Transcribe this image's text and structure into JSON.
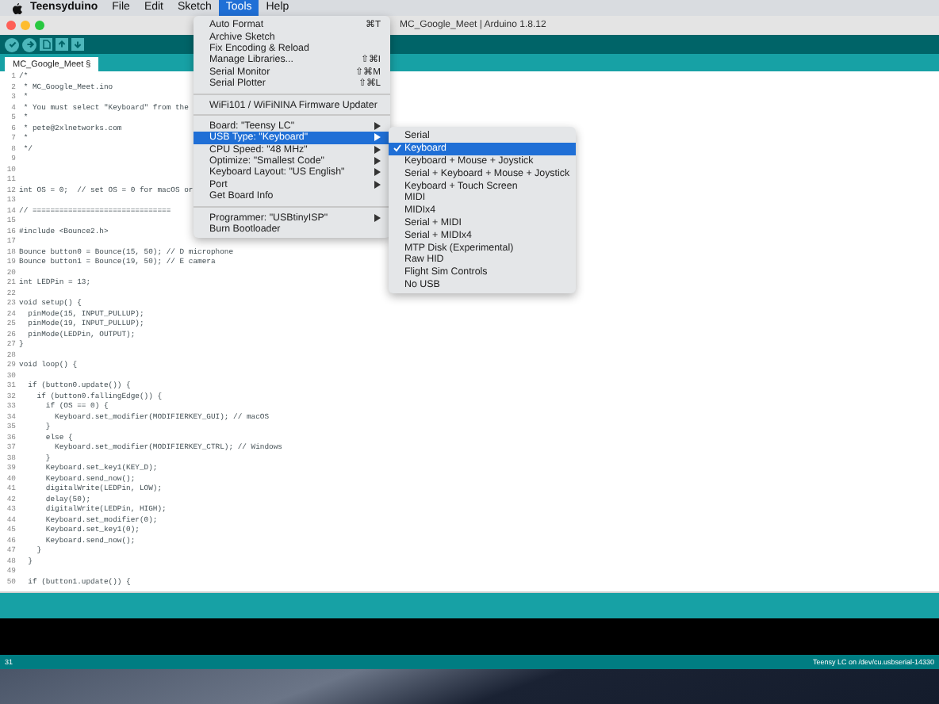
{
  "menubar": {
    "items": [
      {
        "label": "Teensyduino",
        "kind": "app",
        "selected": false
      },
      {
        "label": "File",
        "kind": "menu",
        "selected": false
      },
      {
        "label": "Edit",
        "kind": "menu",
        "selected": false
      },
      {
        "label": "Sketch",
        "kind": "menu",
        "selected": false
      },
      {
        "label": "Tools",
        "kind": "menu",
        "selected": true
      },
      {
        "label": "Help",
        "kind": "menu",
        "selected": false
      }
    ]
  },
  "window": {
    "title": "MC_Google_Meet | Arduino 1.8.12"
  },
  "tabs": [
    {
      "label": "MC_Google_Meet §",
      "selected": true
    }
  ],
  "editor": {
    "lines": [
      {
        "number": "1",
        "code": "/*"
      },
      {
        "number": "2",
        "code": " * MC_Google_Meet.ino"
      },
      {
        "number": "3",
        "code": " *"
      },
      {
        "number": "4",
        "code": " * You must select \"Keyboard\" from the"
      },
      {
        "number": "5",
        "code": " *"
      },
      {
        "number": "6",
        "code": " * pete@2xlnetworks.com"
      },
      {
        "number": "7",
        "code": " *"
      },
      {
        "number": "8",
        "code": " */"
      },
      {
        "number": "9"
      },
      {
        "number": "10"
      },
      {
        "number": "11"
      },
      {
        "number": "12",
        "code": "int OS = 0;  // set OS = 0 for macOS or"
      },
      {
        "number": "13"
      },
      {
        "number": "14",
        "code": "// ==============================="
      },
      {
        "number": "15"
      },
      {
        "number": "16",
        "code": "#include <Bounce2.h>"
      },
      {
        "number": "17"
      },
      {
        "number": "18",
        "code": "Bounce button0 = Bounce(15, 50); // D microphone"
      },
      {
        "number": "19",
        "code": "Bounce button1 = Bounce(19, 50); // E camera"
      },
      {
        "number": "20"
      },
      {
        "number": "21",
        "code": "int LEDPin = 13;"
      },
      {
        "number": "22"
      },
      {
        "number": "23",
        "code": "void setup() {"
      },
      {
        "number": "24",
        "code": "  pinMode(15, INPUT_PULLUP);"
      },
      {
        "number": "25",
        "code": "  pinMode(19, INPUT_PULLUP);"
      },
      {
        "number": "26",
        "code": "  pinMode(LEDPin, OUTPUT);"
      },
      {
        "number": "27",
        "code": "}"
      },
      {
        "number": "28"
      },
      {
        "number": "29",
        "code": "void loop() {"
      },
      {
        "number": "30"
      },
      {
        "number": "31",
        "code": "  if (button0.update()) {"
      },
      {
        "number": "32",
        "code": "    if (button0.fallingEdge()) {"
      },
      {
        "number": "33",
        "code": "      if (OS == 0) {"
      },
      {
        "number": "34",
        "code": "        Keyboard.set_modifier(MODIFIERKEY_GUI); // macOS"
      },
      {
        "number": "35",
        "code": "      }"
      },
      {
        "number": "36",
        "code": "      else {"
      },
      {
        "number": "37",
        "code": "        Keyboard.set_modifier(MODIFIERKEY_CTRL); // Windows"
      },
      {
        "number": "38",
        "code": "      }"
      },
      {
        "number": "39",
        "code": "      Keyboard.set_key1(KEY_D);"
      },
      {
        "number": "40",
        "code": "      Keyboard.send_now();"
      },
      {
        "number": "41",
        "code": "      digitalWrite(LEDPin, LOW);"
      },
      {
        "number": "42",
        "code": "      delay(50);"
      },
      {
        "number": "43",
        "code": "      digitalWrite(LEDPin, HIGH);"
      },
      {
        "number": "44",
        "code": "      Keyboard.set_modifier(0);"
      },
      {
        "number": "45",
        "code": "      Keyboard.set_key1(0);"
      },
      {
        "number": "46",
        "code": "      Keyboard.send_now();"
      },
      {
        "number": "47",
        "code": "    }"
      },
      {
        "number": "48",
        "code": "  }"
      },
      {
        "number": "49"
      },
      {
        "number": "50",
        "code": "  if (button1.update()) {"
      }
    ]
  },
  "status_bar": {
    "line": "31",
    "board": "Teensy LC on /dev/cu.usbserial-14330"
  },
  "tools_menu": {
    "items": [
      {
        "kind": "item",
        "label": "Auto Format",
        "shortcut": "⌘T",
        "submenu": false,
        "selected": false
      },
      {
        "kind": "item",
        "label": "Archive Sketch",
        "submenu": false,
        "selected": false
      },
      {
        "kind": "item",
        "label": "Fix Encoding & Reload",
        "submenu": false,
        "selected": false
      },
      {
        "kind": "item",
        "label": "Manage Libraries...",
        "shortcut": "⇧⌘I",
        "submenu": false,
        "selected": false
      },
      {
        "kind": "item",
        "label": "Serial Monitor",
        "shortcut": "⇧⌘M",
        "submenu": false,
        "selected": false
      },
      {
        "kind": "item",
        "label": "Serial Plotter",
        "shortcut": "⇧⌘L",
        "submenu": false,
        "selected": false
      },
      {
        "kind": "separator"
      },
      {
        "kind": "item",
        "label": "WiFi101 / WiFiNINA Firmware Updater",
        "submenu": false,
        "selected": false
      },
      {
        "kind": "separator"
      },
      {
        "kind": "item",
        "label": "Board: \"Teensy LC\"",
        "submenu": true,
        "selected": false
      },
      {
        "kind": "item",
        "label": "USB Type: \"Keyboard\"",
        "submenu": true,
        "selected": true
      },
      {
        "kind": "item",
        "label": "CPU Speed: \"48 MHz\"",
        "submenu": true,
        "selected": false
      },
      {
        "kind": "item",
        "label": "Optimize: \"Smallest Code\"",
        "submenu": true,
        "selected": false
      },
      {
        "kind": "item",
        "label": "Keyboard Layout: \"US English\"",
        "submenu": true,
        "selected": false
      },
      {
        "kind": "item",
        "label": "Port",
        "submenu": true,
        "selected": false
      },
      {
        "kind": "item",
        "label": "Get Board Info",
        "submenu": false,
        "selected": false
      },
      {
        "kind": "separator"
      },
      {
        "kind": "item",
        "label": "Programmer: \"USBtinyISP\"",
        "submenu": true,
        "selected": false
      },
      {
        "kind": "item",
        "label": "Burn Bootloader",
        "submenu": false,
        "selected": false
      }
    ]
  },
  "usb_type_submenu": {
    "items": [
      {
        "label": "Serial",
        "checked": false,
        "selected": false
      },
      {
        "label": "Keyboard",
        "checked": true,
        "selected": true
      },
      {
        "label": "Keyboard + Mouse + Joystick",
        "checked": false,
        "selected": false
      },
      {
        "label": "Serial + Keyboard + Mouse + Joystick",
        "checked": false,
        "selected": false
      },
      {
        "label": "Keyboard + Touch Screen",
        "checked": false,
        "selected": false
      },
      {
        "label": "MIDI",
        "checked": false,
        "selected": false
      },
      {
        "label": "MIDIx4",
        "checked": false,
        "selected": false
      },
      {
        "label": "Serial + MIDI",
        "checked": false,
        "selected": false
      },
      {
        "label": "Serial + MIDIx4",
        "checked": false,
        "selected": false
      },
      {
        "label": "MTP Disk (Experimental)",
        "checked": false,
        "selected": false
      },
      {
        "label": "Raw HID",
        "checked": false,
        "selected": false
      },
      {
        "label": "Flight Sim Controls",
        "checked": false,
        "selected": false
      },
      {
        "label": "No USB",
        "checked": false,
        "selected": false
      }
    ]
  }
}
